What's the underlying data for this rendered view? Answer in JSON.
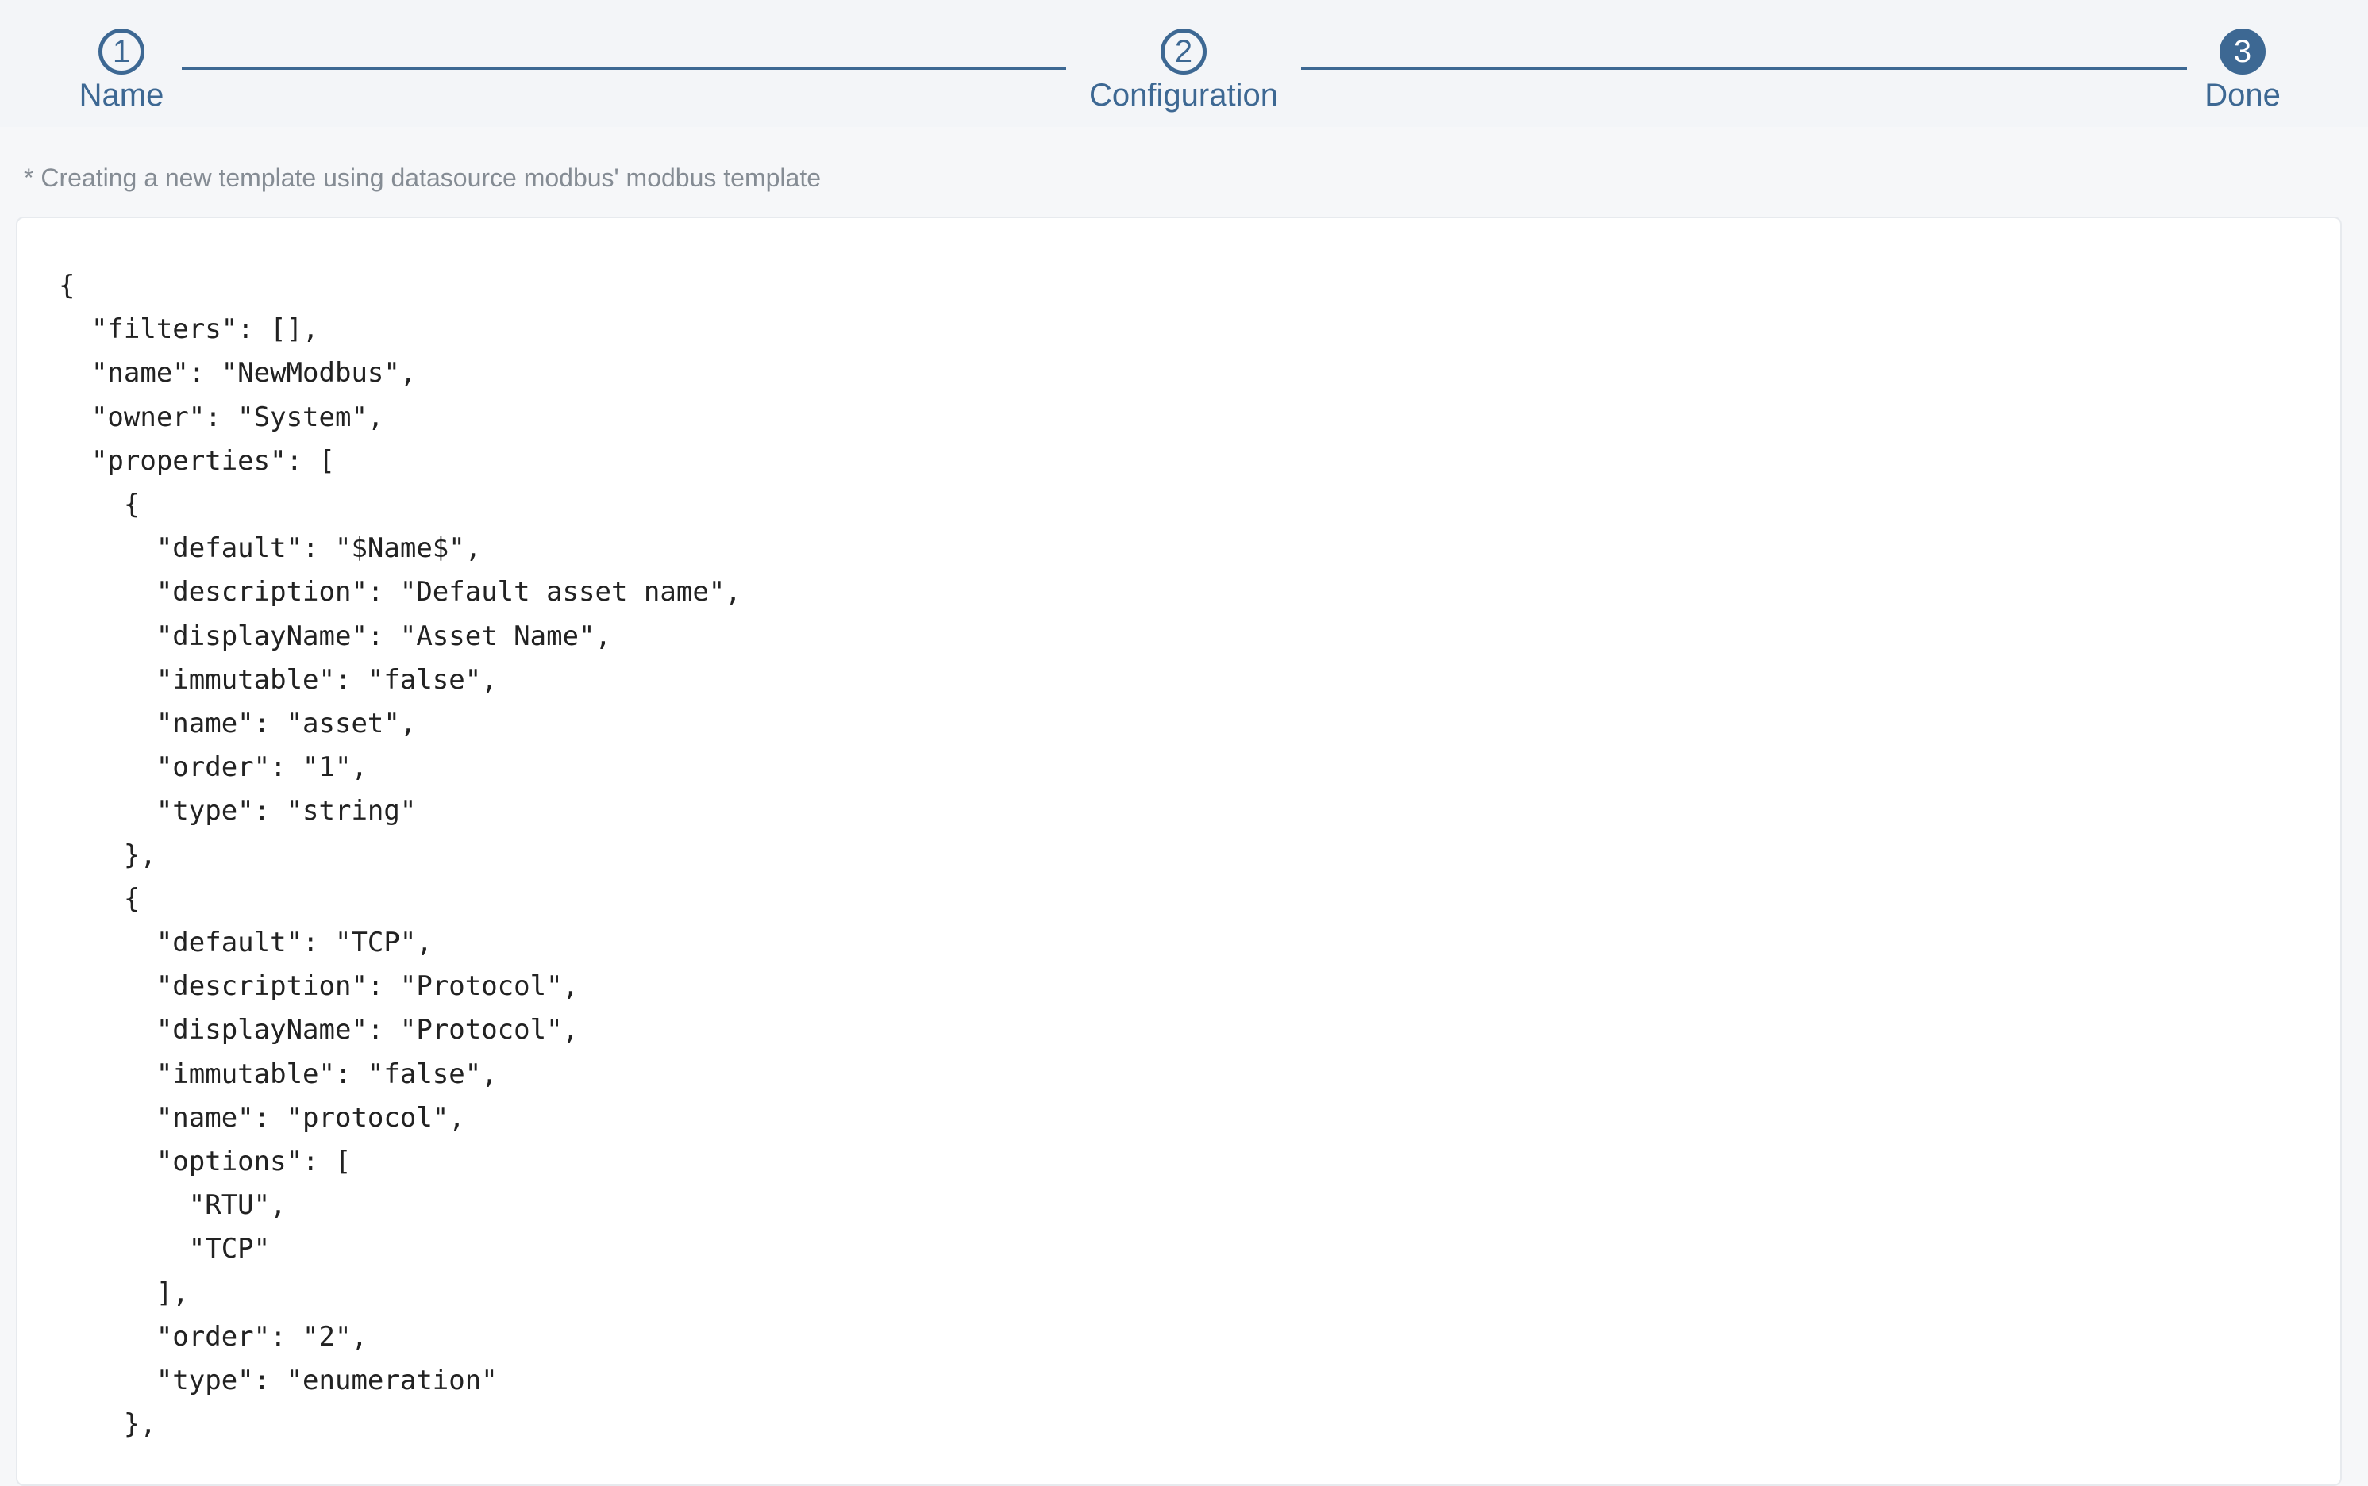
{
  "stepper": {
    "steps": [
      {
        "number": "1",
        "label": "Name",
        "state": "completed"
      },
      {
        "number": "2",
        "label": "Configuration",
        "state": "completed"
      },
      {
        "number": "3",
        "label": "Done",
        "state": "active"
      }
    ],
    "accent_color": "#3d6893"
  },
  "note": "* Creating a new template using datasource modbus' modbus template",
  "code": "{\n  \"filters\": [],\n  \"name\": \"NewModbus\",\n  \"owner\": \"System\",\n  \"properties\": [\n    {\n      \"default\": \"$Name$\",\n      \"description\": \"Default asset name\",\n      \"displayName\": \"Asset Name\",\n      \"immutable\": \"false\",\n      \"name\": \"asset\",\n      \"order\": \"1\",\n      \"type\": \"string\"\n    },\n    {\n      \"default\": \"TCP\",\n      \"description\": \"Protocol\",\n      \"displayName\": \"Protocol\",\n      \"immutable\": \"false\",\n      \"name\": \"protocol\",\n      \"options\": [\n        \"RTU\",\n        \"TCP\"\n      ],\n      \"order\": \"2\",\n      \"type\": \"enumeration\"\n    },"
}
